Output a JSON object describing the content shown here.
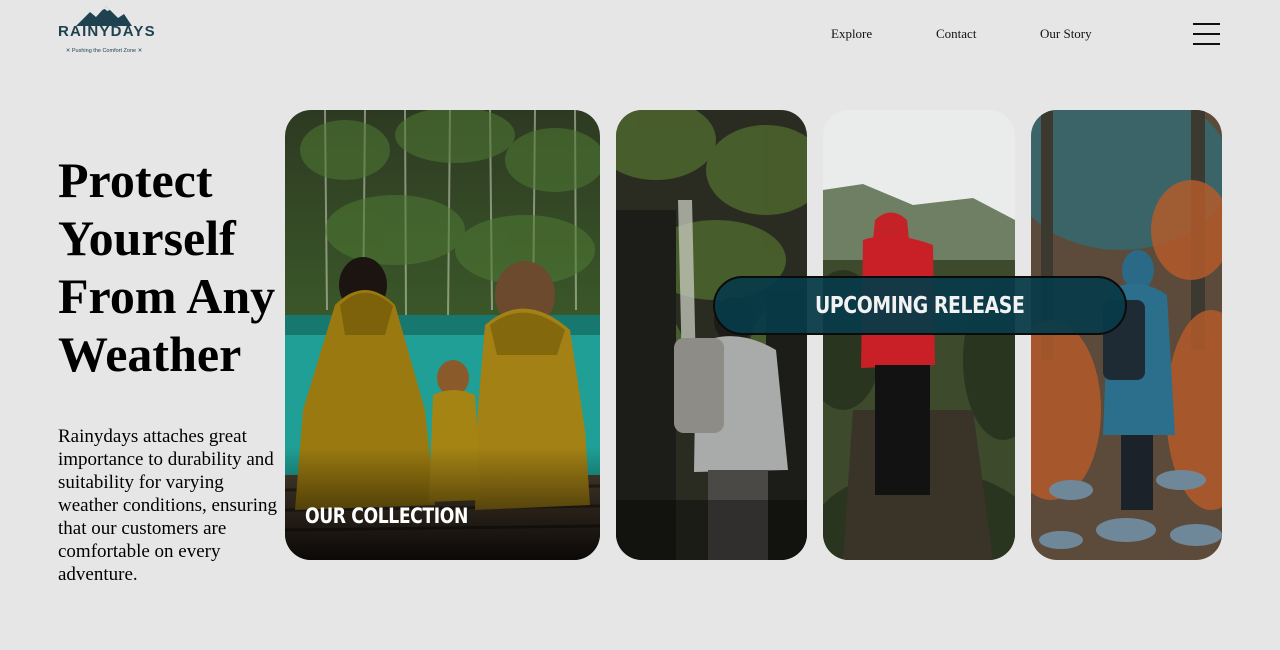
{
  "brand": {
    "name": "RAINYDAYS",
    "tagline": "✕ Pushing the Comfort Zone ✕",
    "color": "#1f4250"
  },
  "nav": {
    "items": [
      {
        "label": "Explore"
      },
      {
        "label": "Contact"
      },
      {
        "label": "Our Story"
      }
    ],
    "menu_icon": "hamburger-menu-icon"
  },
  "hero": {
    "title_lines": [
      "Protect",
      "Yourself",
      "From Any",
      "Weather"
    ],
    "description": "Rainydays attaches great importance to durability and suitability for varying weather conditions, ensuring that our customers are comfortable on every adventure."
  },
  "cards": {
    "collection_label": "OUR COLLECTION",
    "release_label": "UPCOMING RELEASE",
    "pill_color": "#083a48",
    "images": [
      "couple-with-dog-in-yellow-raincoats-by-lake",
      "hiker-with-grey-backpack-by-waterfall",
      "hiker-in-red-jacket-on-bridge",
      "hiker-in-blue-raincoat-on-forest-trail"
    ]
  }
}
